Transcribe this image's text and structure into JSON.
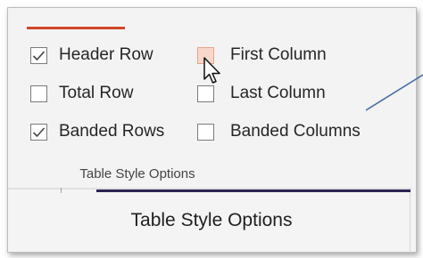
{
  "ribbon_group": {
    "options": {
      "header_row": {
        "label": "Header Row",
        "checked": true
      },
      "total_row": {
        "label": "Total Row",
        "checked": false
      },
      "banded_rows": {
        "label": "Banded Rows",
        "checked": true
      },
      "first_column": {
        "label": "First Column",
        "checked": false
      },
      "last_column": {
        "label": "Last Column",
        "checked": false
      },
      "banded_columns": {
        "label": "Banded Columns",
        "checked": false
      }
    },
    "group_title": "Table Style Options"
  },
  "caption": "Table Style Options",
  "colors": {
    "accent": "#d24726",
    "hover_fill": "#f8d7cb",
    "underline": "#2b2452",
    "pointer_line": "#4a6fa5"
  },
  "icons": {
    "check": "checkmark-icon",
    "cursor": "mouse-pointer-icon"
  }
}
